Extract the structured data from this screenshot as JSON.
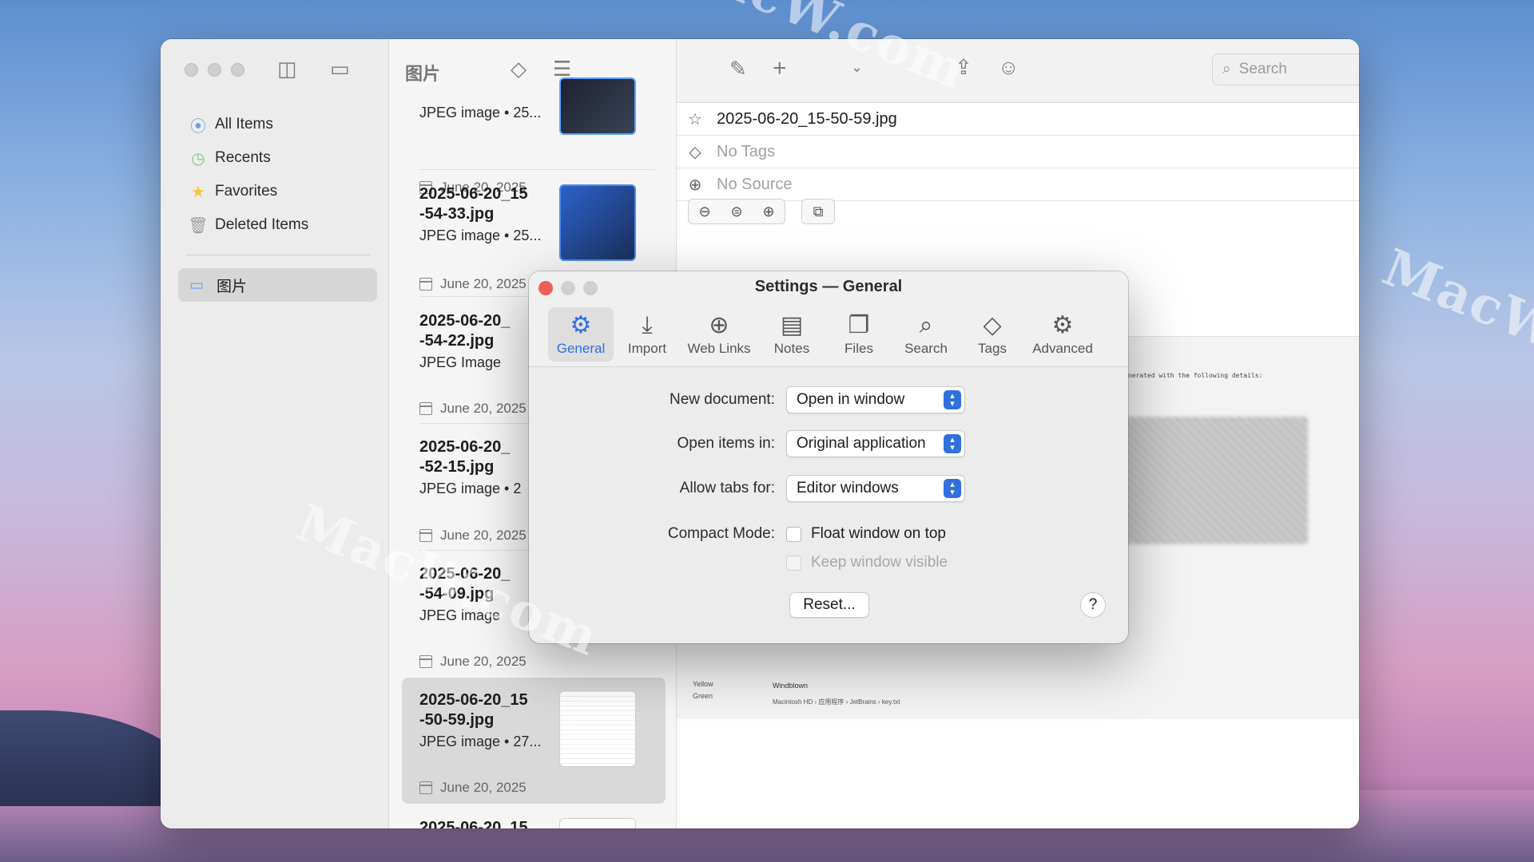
{
  "colors": {
    "accent": "#2f6fde",
    "close_red": "#ec5e57",
    "window_bg": "#ffffff"
  },
  "watermark": {
    "text": "MacW.com"
  },
  "sidebar": {
    "items": [
      {
        "label": "All Items",
        "icon": "all-items-icon"
      },
      {
        "label": "Recents",
        "icon": "clock-icon"
      },
      {
        "label": "Favorites",
        "icon": "star-icon"
      },
      {
        "label": "Deleted Items",
        "icon": "trash-icon"
      }
    ],
    "folder": {
      "label": "图片",
      "icon": "folder-icon"
    }
  },
  "middle": {
    "title": "图片",
    "items": [
      {
        "name": "",
        "type": "JPEG image • 25...",
        "date": "June 20, 2025"
      },
      {
        "name": "2025-06-20_15\n-54-33.jpg",
        "type": "JPEG image • 25...",
        "date": "June 20, 2025"
      },
      {
        "name": "2025-06-20_\n-54-22.jpg",
        "type": "JPEG Image",
        "date": "June 20, 2025"
      },
      {
        "name": "2025-06-20_\n-52-15.jpg",
        "type": "JPEG image • 2",
        "date": "June 20, 2025"
      },
      {
        "name": "2025-06-20_\n-54-09.jpg",
        "type": "JPEG image",
        "date": "June 20, 2025"
      },
      {
        "name": "2025-06-20_15\n-50-59.jpg",
        "type": "JPEG image • 27...",
        "date": "June 20, 2025"
      },
      {
        "name": "2025-06-20_15",
        "type": "",
        "date": ""
      }
    ]
  },
  "toolbar": {
    "search_placeholder": "Search"
  },
  "detail": {
    "filename": "2025-06-20_15-50-59.jpg",
    "tags": "No Tags",
    "source": "No Source"
  },
  "dialog": {
    "title": "Settings — General",
    "tabs": [
      {
        "label": "General",
        "icon": "gear-icon"
      },
      {
        "label": "Import",
        "icon": "import-icon"
      },
      {
        "label": "Web Links",
        "icon": "globe-icon"
      },
      {
        "label": "Notes",
        "icon": "notes-icon"
      },
      {
        "label": "Files",
        "icon": "files-icon"
      },
      {
        "label": "Search",
        "icon": "search-icon"
      },
      {
        "label": "Tags",
        "icon": "tag-icon"
      },
      {
        "label": "Advanced",
        "icon": "gears-icon"
      }
    ],
    "new_document": {
      "label": "New document:",
      "value": "Open in window"
    },
    "open_items": {
      "label": "Open items in:",
      "value": "Original application"
    },
    "allow_tabs": {
      "label": "Allow tabs for:",
      "value": "Editor windows"
    },
    "compact_mode": {
      "label": "Compact Mode:",
      "float_on_top": "Float window on top",
      "keep_visible": "Keep window visible"
    },
    "reset_label": "Reset...",
    "help_label": "?"
  },
  "preview_snippet": {
    "text1": "enerated with the following details:",
    "tag_yellow": "Yellow",
    "tag_green": "Green",
    "windblown": "Windblown",
    "path": "Macintosh HD › 应用程序 › JetBrains › key.txt"
  }
}
